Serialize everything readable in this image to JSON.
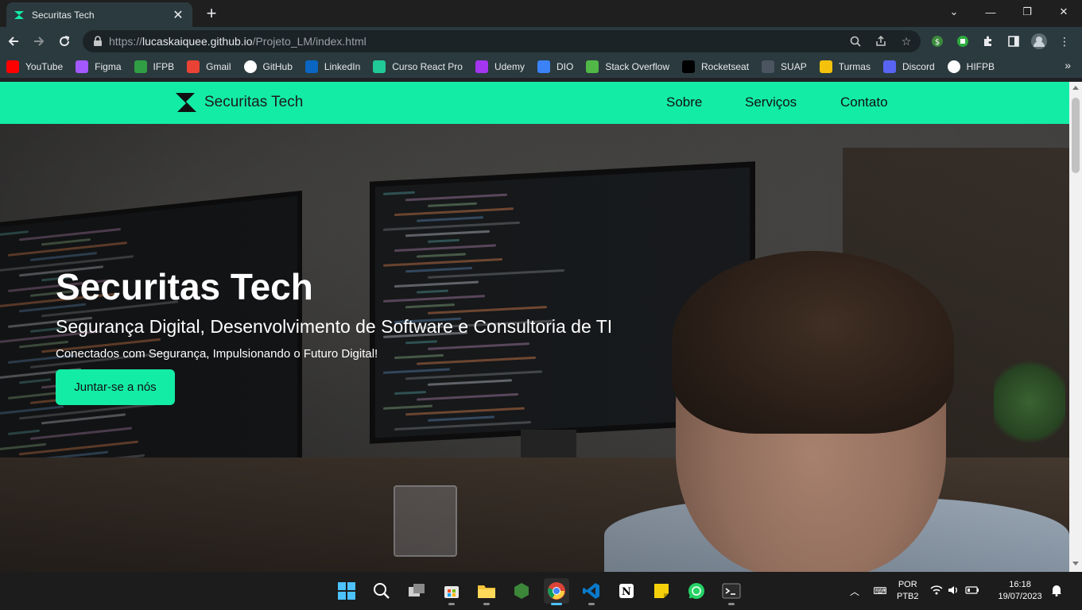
{
  "browser": {
    "tab_title": "Securitas Tech",
    "new_tab": "+",
    "close_tab": "✕",
    "url_scheme": "https://",
    "url_host": "lucaskaiquee.github.io",
    "url_path": "/Projeto_LM/index.html",
    "bookmarks": [
      {
        "label": "YouTube",
        "icon": "youtube-icon",
        "color": "#ff0000"
      },
      {
        "label": "Figma",
        "icon": "figma-icon",
        "color": "#a259ff"
      },
      {
        "label": "IFPB",
        "icon": "ifpb-icon",
        "color": "#2f9e44"
      },
      {
        "label": "Gmail",
        "icon": "gmail-icon",
        "color": "#ea4335"
      },
      {
        "label": "GitHub",
        "icon": "github-icon",
        "color": "#ffffff"
      },
      {
        "label": "LinkedIn",
        "icon": "linkedin-icon",
        "color": "#0a66c2"
      },
      {
        "label": "Curso React Pro",
        "icon": "react-course-icon",
        "color": "#20c997"
      },
      {
        "label": "Udemy",
        "icon": "udemy-icon",
        "color": "#a435f0"
      },
      {
        "label": "DIO",
        "icon": "dio-icon",
        "color": "#3b82f6"
      },
      {
        "label": "Stack Overflow",
        "icon": "stackoverflow-icon",
        "color": "#51b848"
      },
      {
        "label": "Rocketseat",
        "icon": "rocketseat-icon",
        "color": "#000000"
      },
      {
        "label": "SUAP",
        "icon": "suap-icon",
        "color": "#4a5560"
      },
      {
        "label": "Turmas",
        "icon": "classroom-icon",
        "color": "#f4c20d"
      },
      {
        "label": "Discord",
        "icon": "discord-icon",
        "color": "#5865f2"
      },
      {
        "label": "HIFPB",
        "icon": "hifpb-icon",
        "color": "#ffffff"
      }
    ],
    "bookmarks_more": "»"
  },
  "site": {
    "brand": "Securitas Tech",
    "brand_color": "#13eca5",
    "nav": [
      "Sobre",
      "Serviços",
      "Contato"
    ],
    "hero": {
      "title": "Securitas Tech",
      "subtitle": "Segurança Digital, Desenvolvimento de Software e Consultoria de TI",
      "tagline": "Conectados com Segurança, Impulsionando o Futuro Digital!",
      "cta": "Juntar-se a nós"
    }
  },
  "taskbar": {
    "apps": [
      "start-icon",
      "search-icon",
      "task-view-icon",
      "store-icon",
      "file-explorer-icon",
      "node-icon",
      "chrome-icon",
      "vscode-icon",
      "notion-icon",
      "sticky-notes-icon",
      "whatsapp-icon",
      "terminal-icon"
    ],
    "language_line1": "POR",
    "language_line2": "PTB2",
    "time": "16:18",
    "date": "19/07/2023"
  }
}
